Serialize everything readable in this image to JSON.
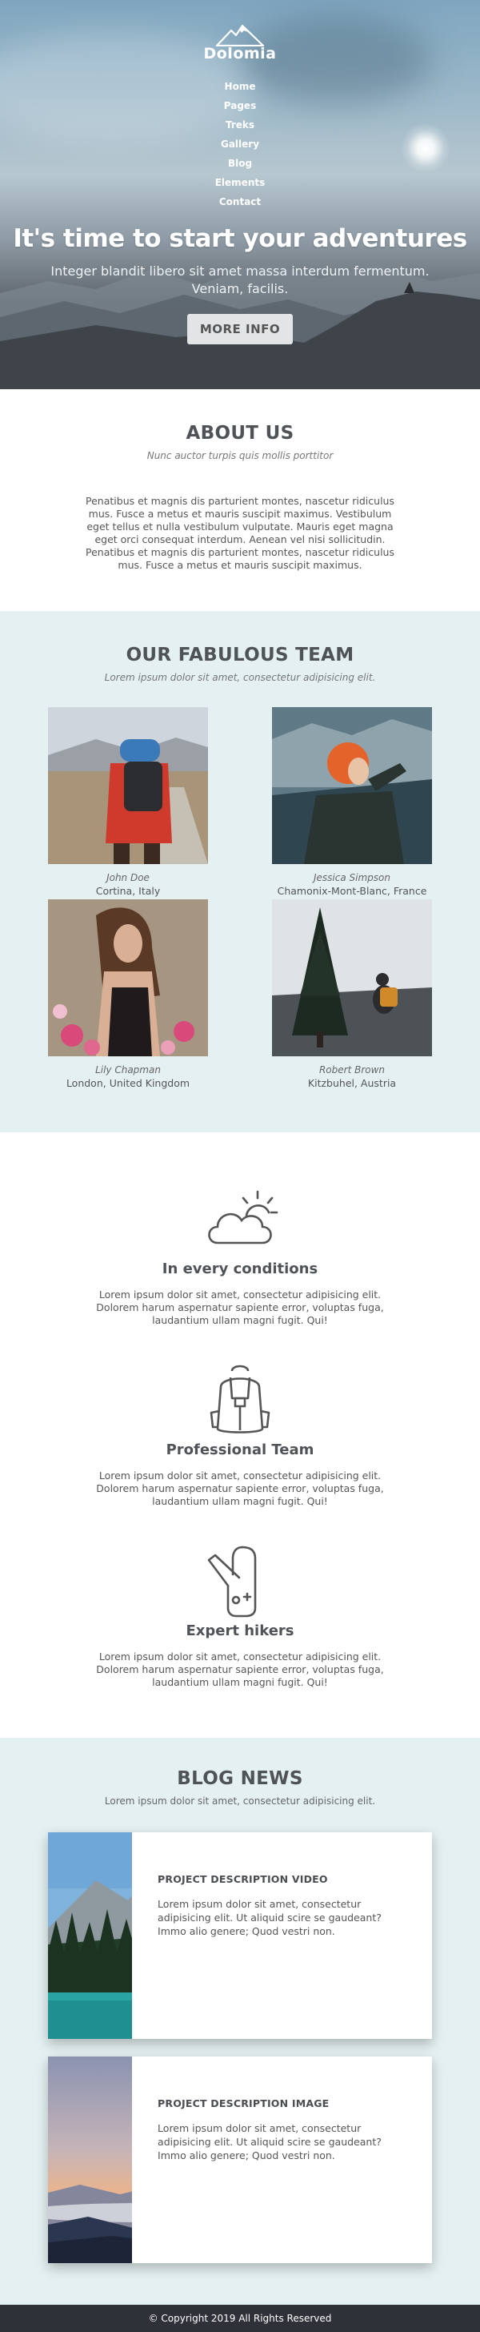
{
  "brand": {
    "name": "Dolomia",
    "logo_icon": "mountain-logo-icon"
  },
  "nav": {
    "items": [
      {
        "label": "Home"
      },
      {
        "label": "Pages"
      },
      {
        "label": "Treks"
      },
      {
        "label": "Gallery"
      },
      {
        "label": "Blog"
      },
      {
        "label": "Elements"
      },
      {
        "label": "Contact"
      }
    ]
  },
  "hero": {
    "title": "It's time to start your adventures",
    "subtitle": "Integer blandit libero sit amet massa interdum fermentum. Veniam, facilis.",
    "button_label": "MORE INFO"
  },
  "about": {
    "title": "ABOUT US",
    "subtitle": "Nunc auctor turpis quis mollis porttitor",
    "body": "Penatibus et magnis dis parturient montes, nascetur ridiculus mus. Fusce a metus et mauris suscipit maximus. Vestibulum eget tellus et nulla vestibulum vulputate. Mauris eget magna eget orci consequat interdum. Aenean vel nisi sollicitudin. Penatibus et magnis dis parturient montes, nascetur ridiculus mus. Fusce a metus et mauris suscipit maximus."
  },
  "team": {
    "title": "OUR FABULOUS TEAM",
    "subtitle": "Lorem ipsum dolor sit amet, consectetur adipisicing elit.",
    "members": [
      {
        "name": "John Doe",
        "location": "Cortina, Italy"
      },
      {
        "name": "Jessica Simpson",
        "location": "Chamonix-Mont-Blanc, France"
      },
      {
        "name": "Lily Chapman",
        "location": "London, United Kingdom"
      },
      {
        "name": "Robert Brown",
        "location": "Kitzbuhel, Austria"
      }
    ]
  },
  "features": [
    {
      "icon": "cloud-sun-icon",
      "title": "In every conditions",
      "text": "Lorem ipsum dolor sit amet, consectetur adipisicing elit. Dolorem harum aspernatur sapiente error, voluptas fuga, laudantium ullam magni fugit. Qui!"
    },
    {
      "icon": "backpack-icon",
      "title": "Professional Team",
      "text": "Lorem ipsum dolor sit amet, consectetur adipisicing elit. Dolorem harum aspernatur sapiente error, voluptas fuga, laudantium ullam magni fugit. Qui!"
    },
    {
      "icon": "swiss-knife-icon",
      "title": "Expert hikers",
      "text": "Lorem ipsum dolor sit amet, consectetur adipisicing elit. Dolorem harum aspernatur sapiente error, voluptas fuga, laudantium ullam magni fugit. Qui!"
    }
  ],
  "blog": {
    "title": "BLOG NEWS",
    "subtitle": "Lorem ipsum dolor sit amet, consectetur adipisicing elit.",
    "posts": [
      {
        "title": "PROJECT DESCRIPTION VIDEO",
        "text": "Lorem ipsum dolor sit amet, consectetur adipisicing elit. Ut aliquid scire se gaudeant? Immo alio genere; Quod vestri non."
      },
      {
        "title": "PROJECT DESCRIPTION IMAGE",
        "text": "Lorem ipsum dolor sit amet, consectetur adipisicing elit. Ut aliquid scire se gaudeant? Immo alio genere; Quod vestri non."
      }
    ]
  },
  "footer": {
    "copyright": "© Copyright 2019 All Rights Reserved"
  },
  "colors": {
    "light_section_bg": "#e4f0f1",
    "footer_bg": "#2e3138",
    "heading": "#4f5358"
  }
}
